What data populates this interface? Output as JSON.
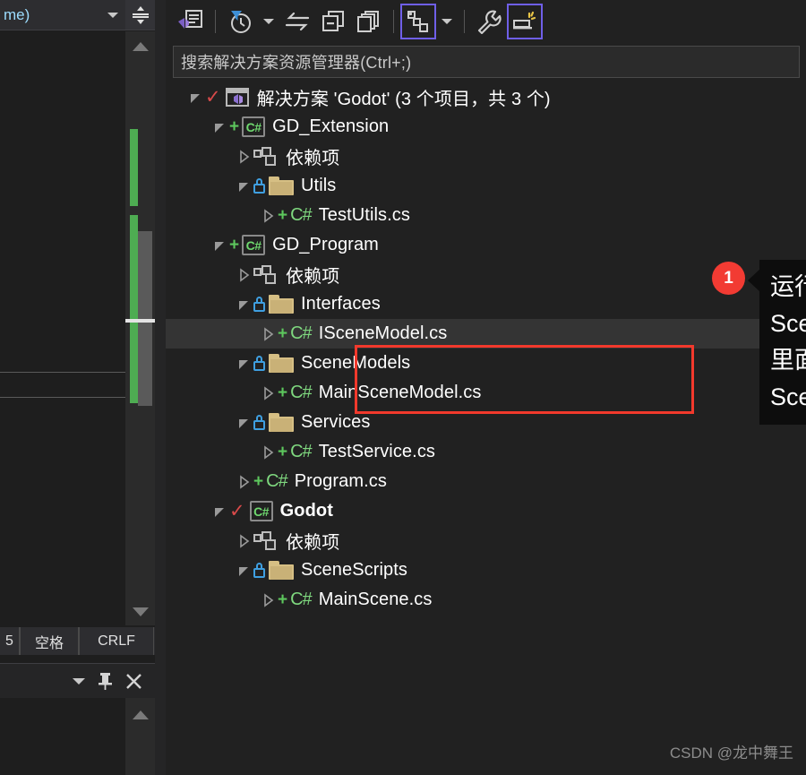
{
  "left_panel": {
    "dropdown_value": "me)",
    "status_bar": {
      "col": "5",
      "spaces": "空格",
      "line_ending": "CRLF"
    },
    "icons": {
      "split_view": "split-view-icon",
      "caret_down": "chevron-down-icon",
      "pin": "pin-icon",
      "close": "close-icon",
      "scroll_up": "scroll-up-arrow-icon",
      "scroll_down": "scroll-down-arrow-icon"
    }
  },
  "solution_explorer": {
    "toolbar": [
      {
        "name": "home-solution-icon",
        "label": "主页",
        "focused": false
      },
      {
        "name": "pending-changes-filter-icon",
        "label": "挂起的更改筛选器",
        "focused": false,
        "has_caret": true
      },
      {
        "name": "sync-with-active-document-icon",
        "label": "与活动文档同步",
        "focused": false
      },
      {
        "name": "collapse-all-icon",
        "label": "全部折叠",
        "focused": false
      },
      {
        "name": "show-all-files-icon",
        "label": "显示所有文件",
        "focused": false
      },
      {
        "name": "view-class-diagram-icon",
        "label": "视图",
        "focused": true,
        "has_caret": true
      },
      {
        "name": "properties-wrench-icon",
        "label": "属性",
        "focused": false
      },
      {
        "name": "preview-selected-items-icon",
        "label": "预览选定项",
        "focused": true
      }
    ],
    "search": {
      "placeholder": "搜索解决方案资源管理器(Ctrl+;)",
      "value": ""
    },
    "tree": [
      {
        "id": "solution",
        "label": "解决方案 'Godot' (3 个项目，共 3 个)",
        "indent": 0,
        "expander": "open",
        "icon": "solution",
        "check": true,
        "bold": false,
        "selected": false
      },
      {
        "id": "gd-extension",
        "label": "GD_Extension",
        "indent": 1,
        "expander": "open",
        "icon": "csproj",
        "plus": true,
        "bold": false,
        "selected": false
      },
      {
        "id": "ext-dependencies",
        "label": "依赖项",
        "indent": 2,
        "expander": "closed",
        "icon": "deps",
        "bold": false,
        "selected": false
      },
      {
        "id": "ext-utils",
        "label": "Utils",
        "indent": 2,
        "expander": "open",
        "icon": "folder",
        "lock": true,
        "bold": false,
        "selected": false
      },
      {
        "id": "test-utils-cs",
        "label": "TestUtils.cs",
        "indent": 3,
        "expander": "closed",
        "icon": "csfile",
        "plus": true,
        "bold": false,
        "selected": false
      },
      {
        "id": "gd-program",
        "label": "GD_Program",
        "indent": 1,
        "expander": "open",
        "icon": "csproj",
        "plus": true,
        "bold": false,
        "selected": false
      },
      {
        "id": "prog-dependencies",
        "label": "依赖项",
        "indent": 2,
        "expander": "closed",
        "icon": "deps",
        "bold": false,
        "selected": false
      },
      {
        "id": "interfaces",
        "label": "Interfaces",
        "indent": 2,
        "expander": "open",
        "icon": "folder",
        "lock": true,
        "bold": false,
        "selected": false
      },
      {
        "id": "iscenemodel-cs",
        "label": "ISceneModel.cs",
        "indent": 3,
        "expander": "closed",
        "icon": "csfile",
        "plus": true,
        "bold": false,
        "selected": true
      },
      {
        "id": "scenemodels",
        "label": "SceneModels",
        "indent": 2,
        "expander": "open",
        "icon": "folder",
        "lock": true,
        "bold": false,
        "selected": false
      },
      {
        "id": "mainscenemodel-cs",
        "label": "MainSceneModel.cs",
        "indent": 3,
        "expander": "closed",
        "icon": "csfile",
        "plus": true,
        "bold": false,
        "selected": false
      },
      {
        "id": "services",
        "label": "Services",
        "indent": 2,
        "expander": "open",
        "icon": "folder",
        "lock": true,
        "bold": false,
        "selected": false
      },
      {
        "id": "testservice-cs",
        "label": "TestService.cs",
        "indent": 3,
        "expander": "closed",
        "icon": "csfile",
        "plus": true,
        "bold": false,
        "selected": false
      },
      {
        "id": "program-cs",
        "label": "Program.cs",
        "indent": 2,
        "expander": "closed",
        "icon": "csfile",
        "plus": true,
        "bold": false,
        "selected": false
      },
      {
        "id": "godot",
        "label": "Godot",
        "indent": 1,
        "expander": "open",
        "icon": "csproj",
        "check": true,
        "bold": true,
        "selected": false
      },
      {
        "id": "godot-dependencies",
        "label": "依赖项",
        "indent": 2,
        "expander": "closed",
        "icon": "deps",
        "bold": false,
        "selected": false
      },
      {
        "id": "scenescripts",
        "label": "SceneScripts",
        "indent": 2,
        "expander": "open",
        "icon": "folder",
        "lock": true,
        "bold": false,
        "selected": false
      },
      {
        "id": "mainscene-cs",
        "label": "MainScene.cs",
        "indent": 3,
        "expander": "closed",
        "icon": "csfile",
        "plus": true,
        "bold": false,
        "selected": false
      }
    ]
  },
  "annotation": {
    "badge_number": "1",
    "badge_color": "#f23b33",
    "highlight_box_color": "#f2392c",
    "callout_lines": [
      "运行逻辑放在",
      "SceneModels",
      "里面，命名为",
      "SceneModel"
    ]
  },
  "watermark": "CSDN @龙中舞王"
}
